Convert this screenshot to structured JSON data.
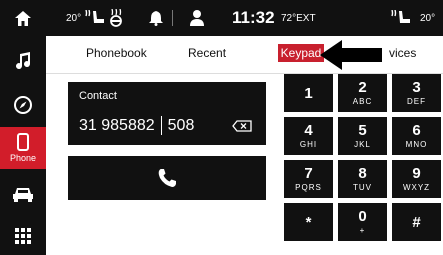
{
  "status": {
    "left_temp": "20°",
    "time": "11:32",
    "ext_temp": "72°EXT",
    "right_temp": "20°"
  },
  "sidebar": {
    "items": [
      {
        "name": "home",
        "label": ""
      },
      {
        "name": "music",
        "label": ""
      },
      {
        "name": "navigation",
        "label": ""
      },
      {
        "name": "phone",
        "label": "Phone"
      },
      {
        "name": "vehicle",
        "label": ""
      },
      {
        "name": "apps",
        "label": ""
      }
    ]
  },
  "tabs": {
    "phonebook": "Phonebook",
    "recent": "Recent",
    "keypad": "Keypad",
    "services": "vices"
  },
  "dialer": {
    "contact_label": "Contact",
    "number_main": "31 985882",
    "number_ext": "508"
  },
  "keypad": [
    {
      "digit": "1",
      "letters": ""
    },
    {
      "digit": "2",
      "letters": "ABC"
    },
    {
      "digit": "3",
      "letters": "DEF"
    },
    {
      "digit": "4",
      "letters": "GHI"
    },
    {
      "digit": "5",
      "letters": "JKL"
    },
    {
      "digit": "6",
      "letters": "MNO"
    },
    {
      "digit": "7",
      "letters": "PQRS"
    },
    {
      "digit": "8",
      "letters": "TUV"
    },
    {
      "digit": "9",
      "letters": "WXYZ"
    },
    {
      "digit": "*",
      "letters": ""
    },
    {
      "digit": "0",
      "letters": "+"
    },
    {
      "digit": "#",
      "letters": ""
    }
  ],
  "colors": {
    "accent": "#c8202e",
    "panel": "#111111"
  }
}
